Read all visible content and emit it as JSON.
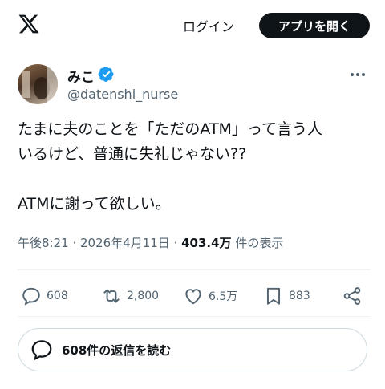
{
  "header": {
    "logo_icon": "x-logo-icon",
    "login_label": "ログイン",
    "open_app_label": "アプリを開く"
  },
  "author": {
    "display_name": "みこ",
    "handle": "@datenshi_nurse",
    "verified_icon": "verified-badge-icon",
    "verified_color": "#1d9bf0"
  },
  "tweet": {
    "text": "たまに夫のことを「ただのATM」って言う人\nいるけど、普通に失礼じゃない??\n\nATMに謝って欲しい。",
    "timestamp": "午後8:21 · 2026年4月11日 · ",
    "views": "403.4万",
    "views_label": " 件の表示"
  },
  "actions": {
    "replies": "608",
    "reposts": "2,800",
    "likes": "6.5万",
    "bookmarks": "883"
  },
  "read_replies_label": "608件の返信を読む"
}
